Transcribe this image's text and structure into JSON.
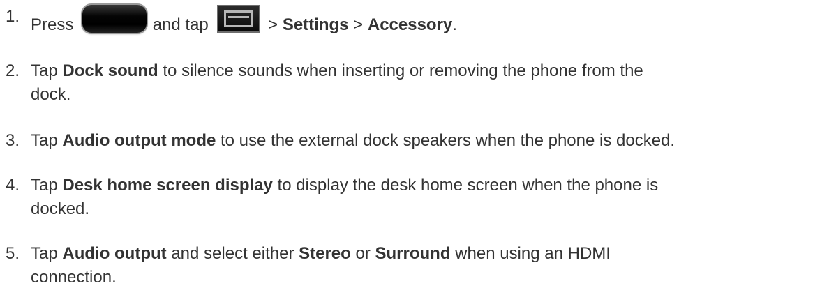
{
  "steps": [
    {
      "number": "1.",
      "t1": "Press",
      "t2": "and tap",
      "t3": " > ",
      "b1": "Settings",
      "t4": " > ",
      "b2": "Accessory",
      "t5": "."
    },
    {
      "number": "2.",
      "t1": "Tap ",
      "b1": "Dock sound",
      "t2": " to silence sounds when inserting or removing the phone from the",
      "t3": "dock."
    },
    {
      "number": "3.",
      "t1": "Tap ",
      "b1": "Audio output mode",
      "t2": " to use the external dock speakers when the phone is docked."
    },
    {
      "number": "4.",
      "t1": "Tap ",
      "b1": "Desk home screen display",
      "t2": " to display the desk home screen when the phone is",
      "t3": "docked."
    },
    {
      "number": "5.",
      "t1": "Tap ",
      "b1": "Audio output",
      "t2": " and select either ",
      "b2": "Stereo",
      "t3": " or ",
      "b3": "Surround",
      "t4": " when using an HDMI",
      "t5": "connection."
    }
  ],
  "icons": {
    "home_key": "home-key-icon",
    "menu_key": "menu-key-icon"
  }
}
